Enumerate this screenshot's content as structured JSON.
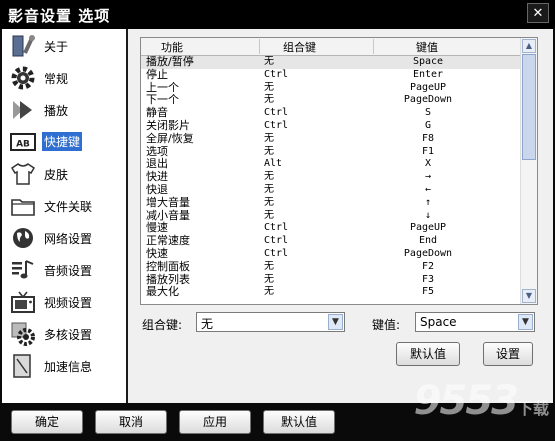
{
  "window": {
    "title": "影音设置 选项",
    "close_label": "✕"
  },
  "sidebar": {
    "items": [
      {
        "label": "关于",
        "icon": "wrench-icon"
      },
      {
        "label": "常规",
        "icon": "gear-icon"
      },
      {
        "label": "播放",
        "icon": "play-icon"
      },
      {
        "label": "快捷键",
        "icon": "ab-keyboard-icon",
        "active": true
      },
      {
        "label": "皮肤",
        "icon": "tshirt-icon"
      },
      {
        "label": "文件关联",
        "icon": "folder-icon"
      },
      {
        "label": "网络设置",
        "icon": "globe-icon"
      },
      {
        "label": "音频设置",
        "icon": "music-icon"
      },
      {
        "label": "视频设置",
        "icon": "tv-icon"
      },
      {
        "label": "多核设置",
        "icon": "cpu-gear-icon"
      },
      {
        "label": "加速信息",
        "icon": "document-icon"
      }
    ]
  },
  "shortcuts": {
    "headers": [
      "功能",
      "组合键",
      "键值"
    ],
    "rows": [
      [
        "播放/暂停",
        "无",
        "Space"
      ],
      [
        "停止",
        "Ctrl",
        "Enter"
      ],
      [
        "上一个",
        "无",
        "PageUP"
      ],
      [
        "下一个",
        "无",
        "PageDown"
      ],
      [
        "静音",
        "Ctrl",
        "S"
      ],
      [
        "关闭影片",
        "Ctrl",
        "G"
      ],
      [
        "全屏/恢复",
        "无",
        "F8"
      ],
      [
        "选项",
        "无",
        "F1"
      ],
      [
        "退出",
        "Alt",
        "X"
      ],
      [
        "快进",
        "无",
        "→"
      ],
      [
        "快退",
        "无",
        "←"
      ],
      [
        "增大音量",
        "无",
        "↑"
      ],
      [
        "减小音量",
        "无",
        "↓"
      ],
      [
        "慢速",
        "Ctrl",
        "PageUP"
      ],
      [
        "正常速度",
        "Ctrl",
        "End"
      ],
      [
        "快速",
        "Ctrl",
        "PageDown"
      ],
      [
        "控制面板",
        "无",
        "F2"
      ],
      [
        "播放列表",
        "无",
        "F3"
      ],
      [
        "最大化",
        "无",
        "F5"
      ]
    ]
  },
  "editor": {
    "combo_label": "组合键:",
    "combo_value": "无",
    "key_label": "键值:",
    "key_value": "Space",
    "default_button": "默认值",
    "set_button": "设置"
  },
  "footer": {
    "ok": "确定",
    "cancel": "取消",
    "apply": "应用",
    "defaults": "默认值"
  },
  "watermark": {
    "main": "9553",
    "suffix": "下载"
  }
}
